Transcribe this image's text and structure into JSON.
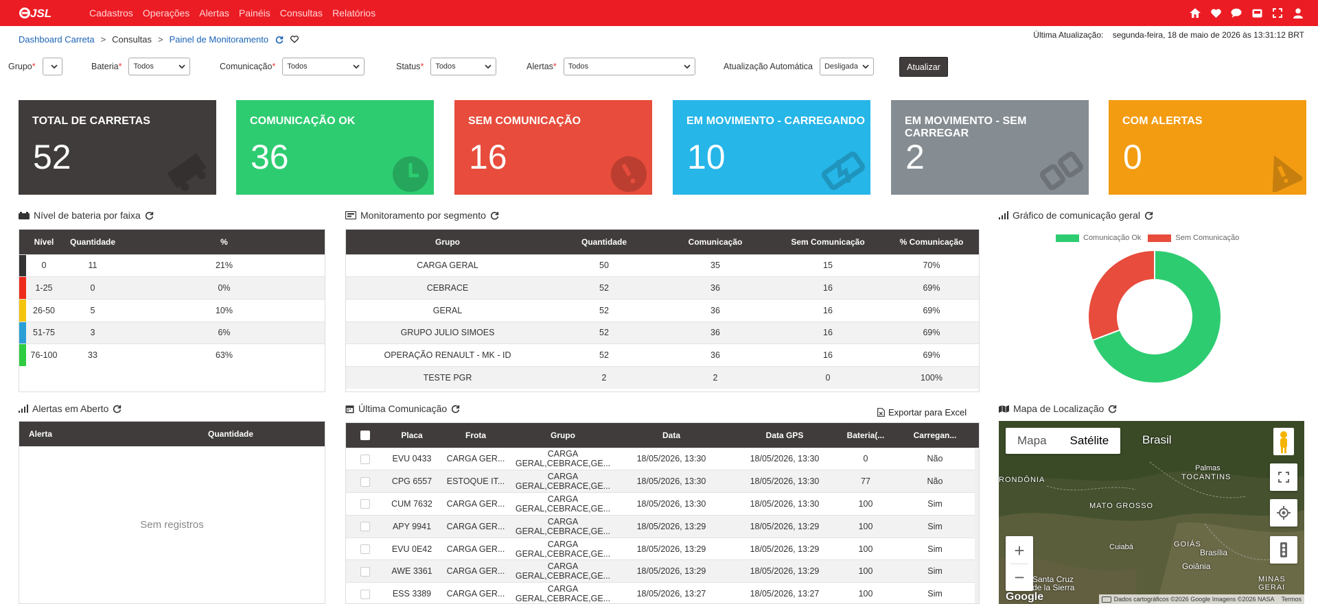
{
  "brand": {
    "logo_text": "JSL"
  },
  "nav": {
    "menu": [
      "Cadastros",
      "Operações",
      "Alertas",
      "Painéis",
      "Consultas",
      "Relatórios"
    ]
  },
  "breadcrumb": {
    "items": [
      "Dashboard Carreta",
      "Consultas",
      "Painel de Monitoramento"
    ],
    "separator": ">"
  },
  "last_update": {
    "label": "Última Atualização:",
    "value": "segunda-feira, 18 de maio de 2026 às 13:31:12 BRT"
  },
  "filters": {
    "grupo": {
      "label": "Grupo",
      "value": ""
    },
    "bateria": {
      "label": "Bateria",
      "value": "Todos"
    },
    "comunicacao": {
      "label": "Comunicação",
      "value": "Todos"
    },
    "status": {
      "label": "Status",
      "value": "Todos"
    },
    "alertas": {
      "label": "Alertas",
      "value": "Todos"
    },
    "auto": {
      "label": "Atualização Automática",
      "value": "Desligada"
    },
    "required_mark": "*",
    "button": "Atualizar"
  },
  "cards": [
    {
      "title": "TOTAL DE CARRETAS",
      "value": "52",
      "color": "#403c3b"
    },
    {
      "title": "COMUNICAÇÃO OK",
      "value": "36",
      "color": "#2ecc71"
    },
    {
      "title": "SEM COMUNICAÇÃO",
      "value": "16",
      "color": "#e74c3c"
    },
    {
      "title": "EM MOVIMENTO - CARREGANDO",
      "value": "10",
      "color": "#26b6e8"
    },
    {
      "title": "EM MOVIMENTO - SEM CARREGAR",
      "value": "2",
      "color": "#858c92"
    },
    {
      "title": "COM ALERTAS",
      "value": "0",
      "color": "#f39c12"
    }
  ],
  "battery": {
    "title": "Nível de bateria por faixa",
    "headers": [
      "Nível",
      "Quantidade",
      "%"
    ],
    "rows": [
      {
        "nivel": "0",
        "qtd": "11",
        "pct": "21%",
        "color": "#333333"
      },
      {
        "nivel": "1-25",
        "qtd": "0",
        "pct": "0%",
        "color": "#ee2a1b"
      },
      {
        "nivel": "26-50",
        "qtd": "5",
        "pct": "10%",
        "color": "#f5c40f"
      },
      {
        "nivel": "51-75",
        "qtd": "3",
        "pct": "6%",
        "color": "#2a9fd6"
      },
      {
        "nivel": "76-100",
        "qtd": "33",
        "pct": "63%",
        "color": "#2ecc40"
      }
    ]
  },
  "segment": {
    "title": "Monitoramento por segmento",
    "headers": [
      "Grupo",
      "Quantidade",
      "Comunicação",
      "Sem Comunicação",
      "% Comunicação"
    ],
    "rows": [
      [
        "CARGA GERAL",
        "50",
        "35",
        "15",
        "70%"
      ],
      [
        "CEBRACE",
        "52",
        "36",
        "16",
        "69%"
      ],
      [
        "GERAL",
        "52",
        "36",
        "16",
        "69%"
      ],
      [
        "GRUPO JULIO SIMOES",
        "52",
        "36",
        "16",
        "69%"
      ],
      [
        "OPERAÇÃO RENAULT - MK - ID",
        "52",
        "36",
        "16",
        "69%"
      ],
      [
        "TESTE PGR",
        "2",
        "2",
        "0",
        "100%"
      ]
    ]
  },
  "comm_chart": {
    "title": "Gráfico de comunicação geral",
    "legend": [
      "Comunicação Ok",
      "Sem Comunicação"
    ],
    "colors": [
      "#2ecc71",
      "#e74c3c"
    ]
  },
  "chart_data": {
    "type": "pie",
    "categories": [
      "Comunicação Ok",
      "Sem Comunicação"
    ],
    "values": [
      36,
      16
    ]
  },
  "alerts": {
    "title": "Alertas em Aberto",
    "headers": [
      "Alerta",
      "Quantidade"
    ],
    "empty": "Sem registros"
  },
  "last_comm": {
    "title": "Última Comunicação",
    "export": "Exportar para Excel",
    "headers": [
      "Placa",
      "Frota",
      "Grupo",
      "Data",
      "Data GPS",
      "Bateria(...",
      "Carregan..."
    ],
    "rows": [
      [
        "EVU 0433",
        "CARGA GER...",
        "CARGA GERAL,CEBRACE,GE...",
        "18/05/2026, 13:30",
        "18/05/2026, 13:30",
        "0",
        "Não"
      ],
      [
        "CPG 6557",
        "ESTOQUE IT...",
        "CARGA GERAL,CEBRACE,GE...",
        "18/05/2026, 13:30",
        "18/05/2026, 13:30",
        "77",
        "Não"
      ],
      [
        "CUM 7632",
        "CARGA GER...",
        "CARGA GERAL,CEBRACE,GE...",
        "18/05/2026, 13:30",
        "18/05/2026, 13:30",
        "100",
        "Sim"
      ],
      [
        "APY 9941",
        "CARGA GER...",
        "CARGA GERAL,CEBRACE,GE...",
        "18/05/2026, 13:29",
        "18/05/2026, 13:29",
        "100",
        "Sim"
      ],
      [
        "EVU 0E42",
        "CARGA GER...",
        "CARGA GERAL,CEBRACE,GE...",
        "18/05/2026, 13:29",
        "18/05/2026, 13:29",
        "100",
        "Sim"
      ],
      [
        "AWE 3361",
        "CARGA GER...",
        "CARGA GERAL,CEBRACE,GE...",
        "18/05/2026, 13:29",
        "18/05/2026, 13:29",
        "100",
        "Sim"
      ],
      [
        "ESS 3389",
        "CARGA GER...",
        "CARGA GERAL,CEBRACE,GE...",
        "18/05/2026, 13:27",
        "18/05/2026, 13:27",
        "100",
        "Sim"
      ]
    ]
  },
  "map": {
    "title": "Mapa de Localização",
    "tabs": [
      "Mapa",
      "Satélite"
    ],
    "labels": {
      "country": "Brasil",
      "palmas": "Palmas",
      "tocantins": "TOCANTINS",
      "rondonia": "RONDÔNIA",
      "mato_grosso": "MATO GROSSO",
      "cuiaba": "Cuiabá",
      "goias": "GOIÁS",
      "brasilia": "Brasília",
      "goiania": "Goiânia",
      "minas": "MINAS GERAI",
      "santa_cruz": "Santa Cruz\nde la Sierra"
    },
    "google": "Google",
    "footer": "Dados cartográficos ©2026 Google Imagens ©2026 NASA",
    "terms": "Termos"
  }
}
